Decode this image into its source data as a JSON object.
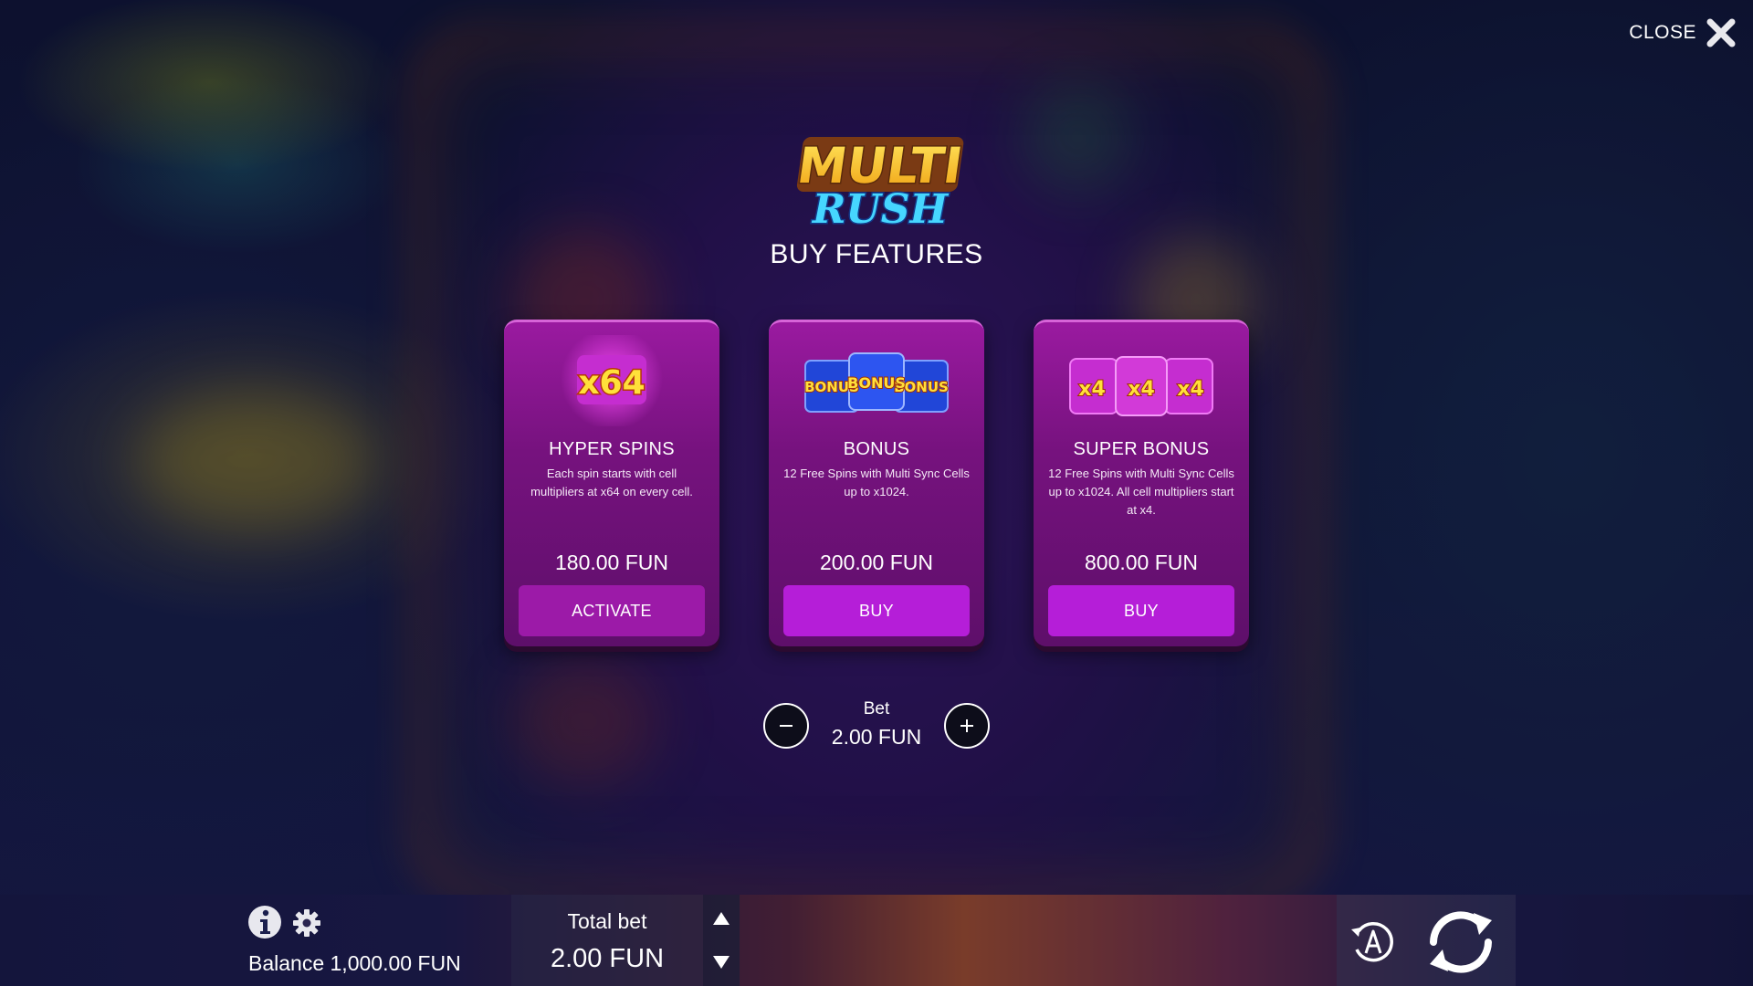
{
  "header": {
    "close_label": "CLOSE",
    "close_icon": "close-x-icon"
  },
  "logo": {
    "line1": "MULTI",
    "line2": "RUSH"
  },
  "title": "BUY FEATURES",
  "features": [
    {
      "art_text": "x64",
      "name": "HYPER SPINS",
      "description": "Each spin starts with cell multipliers at x64 on every cell.",
      "price": "180.00 FUN",
      "button_label": "ACTIVATE"
    },
    {
      "art_text": "BONUS",
      "name": "BONUS",
      "description": "12 Free Spins with Multi Sync Cells up to x1024.",
      "price": "200.00 FUN",
      "button_label": "BUY"
    },
    {
      "art_text": "x4",
      "name": "SUPER BONUS",
      "description": "12 Free Spins with Multi Sync Cells up to x1024. All cell multipliers start at x4.",
      "price": "800.00 FUN",
      "button_label": "BUY"
    }
  ],
  "bet": {
    "label": "Bet",
    "value": "2.00 FUN"
  },
  "bottom_bar": {
    "balance": "Balance 1,000.00 FUN",
    "total_bet_label": "Total bet",
    "total_bet_value": "2.00 FUN"
  },
  "colors": {
    "card_top": "#9a1aa0",
    "card_bottom": "#5e0f6a",
    "buy_button": "#b51ed8",
    "activate_button": "#9c1aa8",
    "logo_gold": "#f5c21b",
    "logo_blue": "#3fd0ff"
  }
}
